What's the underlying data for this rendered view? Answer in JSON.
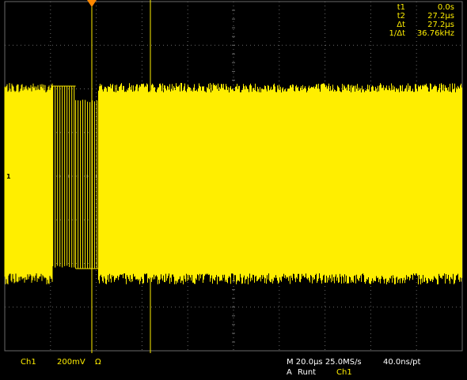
{
  "cursors": {
    "t1_label": "t1",
    "t1_value": "0.0s",
    "t2_label": "t2",
    "t2_value": "27.2µs",
    "dt_label": "Δt",
    "dt_value": "27.2µs",
    "inv_label": "1/Δt",
    "inv_value": "36.76kHz"
  },
  "channel": {
    "name": "Ch1",
    "scale": "200mV",
    "coupling_symbol": "Ω",
    "ground_marker": "1"
  },
  "timebase": {
    "horizontal": "M 20.0µs 25.0MS/s",
    "resolution": "40.0ns/pt"
  },
  "trigger": {
    "mode_line_prefix": "A",
    "type": "Runt",
    "source": "Ch1"
  },
  "colors": {
    "trace": "#ffee00",
    "grid": "#6a6a6a",
    "background": "#000000"
  },
  "waveform": {
    "description_free": true,
    "segments": [
      {
        "from_div": 0.0,
        "to_div": 1.05,
        "kind": "noise"
      },
      {
        "from_div": 1.05,
        "to_div": 1.55,
        "kind": "burst_high"
      },
      {
        "from_div": 1.55,
        "to_div": 2.05,
        "kind": "burst_low"
      },
      {
        "from_div": 2.05,
        "to_div": 10.0,
        "kind": "noise"
      }
    ]
  }
}
